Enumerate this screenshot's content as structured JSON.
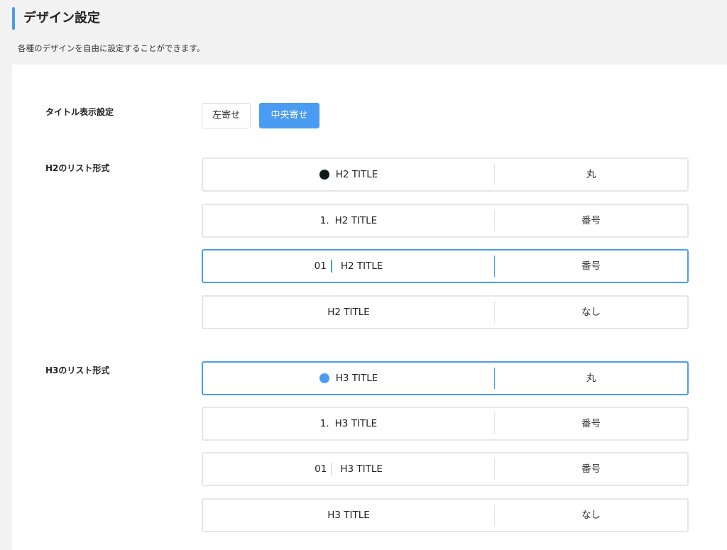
{
  "header": {
    "title": "デザイン設定",
    "description": "各種のデザインを自由に設定することができます。"
  },
  "colors": {
    "accent": "#4a9cf2",
    "dark_dot": "#111a14",
    "border": "#e6e6e6"
  },
  "title_display": {
    "label": "タイトル表示設定",
    "options": [
      {
        "label": "左寄せ",
        "selected": false
      },
      {
        "label": "中央寄せ",
        "selected": true
      }
    ]
  },
  "h2_list": {
    "label": "H2のリスト形式",
    "options": [
      {
        "prefix": "",
        "title": "H2 TITLE",
        "type": "丸",
        "style": "dot-dark",
        "selected": false
      },
      {
        "prefix": "1.",
        "title": "H2 TITLE",
        "type": "番号",
        "style": "number",
        "selected": false
      },
      {
        "prefix": "01",
        "title": "H2 TITLE",
        "type": "番号",
        "style": "number-bar",
        "selected": true
      },
      {
        "prefix": "",
        "title": "H2 TITLE",
        "type": "なし",
        "style": "none",
        "selected": false
      }
    ]
  },
  "h3_list": {
    "label": "H3のリスト形式",
    "options": [
      {
        "prefix": "",
        "title": "H3 TITLE",
        "type": "丸",
        "style": "dot-blue",
        "selected": true
      },
      {
        "prefix": "1.",
        "title": "H3 TITLE",
        "type": "番号",
        "style": "number",
        "selected": false
      },
      {
        "prefix": "01",
        "title": "H3 TITLE",
        "type": "番号",
        "style": "number-bar",
        "selected": false
      },
      {
        "prefix": "",
        "title": "H3 TITLE",
        "type": "なし",
        "style": "none",
        "selected": false
      }
    ]
  }
}
